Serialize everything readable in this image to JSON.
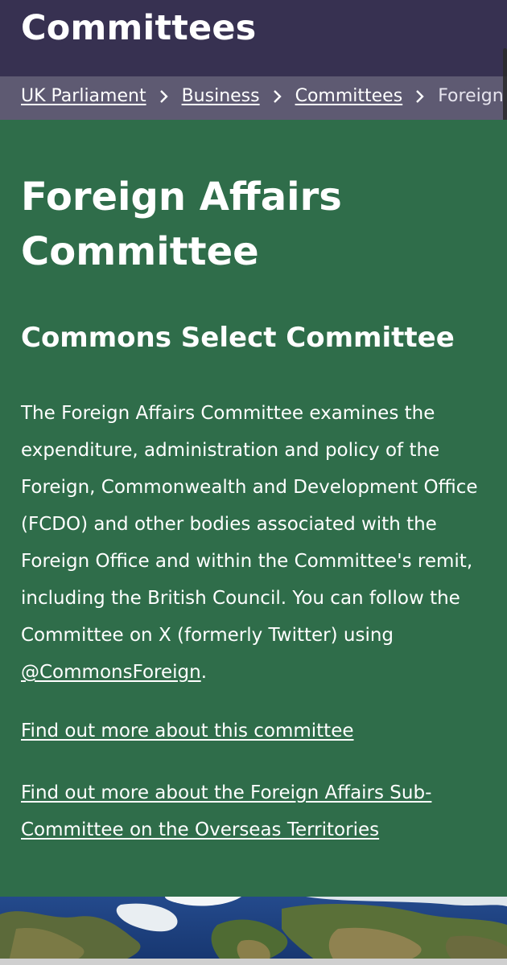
{
  "header": {
    "title": "Committees"
  },
  "breadcrumb": {
    "items": [
      "UK Parliament",
      "Business",
      "Committees"
    ],
    "current": "Foreign"
  },
  "main": {
    "title": "Foreign Affairs Committee",
    "subtitle": "Commons Select Committee",
    "description_before": "The Foreign Affairs Committee examines the expenditure, administration and policy of the Foreign, Commonwealth and Development Office (FCDO) and other bodies associated with the Foreign Office and within the Committee's remit, including the British Council. You can follow the Committee on X (formerly Twitter) using ",
    "description_handle": "@CommonsForeign",
    "description_after": ".",
    "link_about": "Find out more about this committee",
    "link_subcommittee": "Find out more about the Foreign Affairs Sub-Committee on the Overseas Territories"
  },
  "colors": {
    "header_bg": "#373151",
    "breadcrumb_bg": "#5e5a72",
    "main_bg": "#2f6d4a",
    "text": "#ffffff"
  },
  "banner": {
    "image": "world-map-satellite"
  }
}
